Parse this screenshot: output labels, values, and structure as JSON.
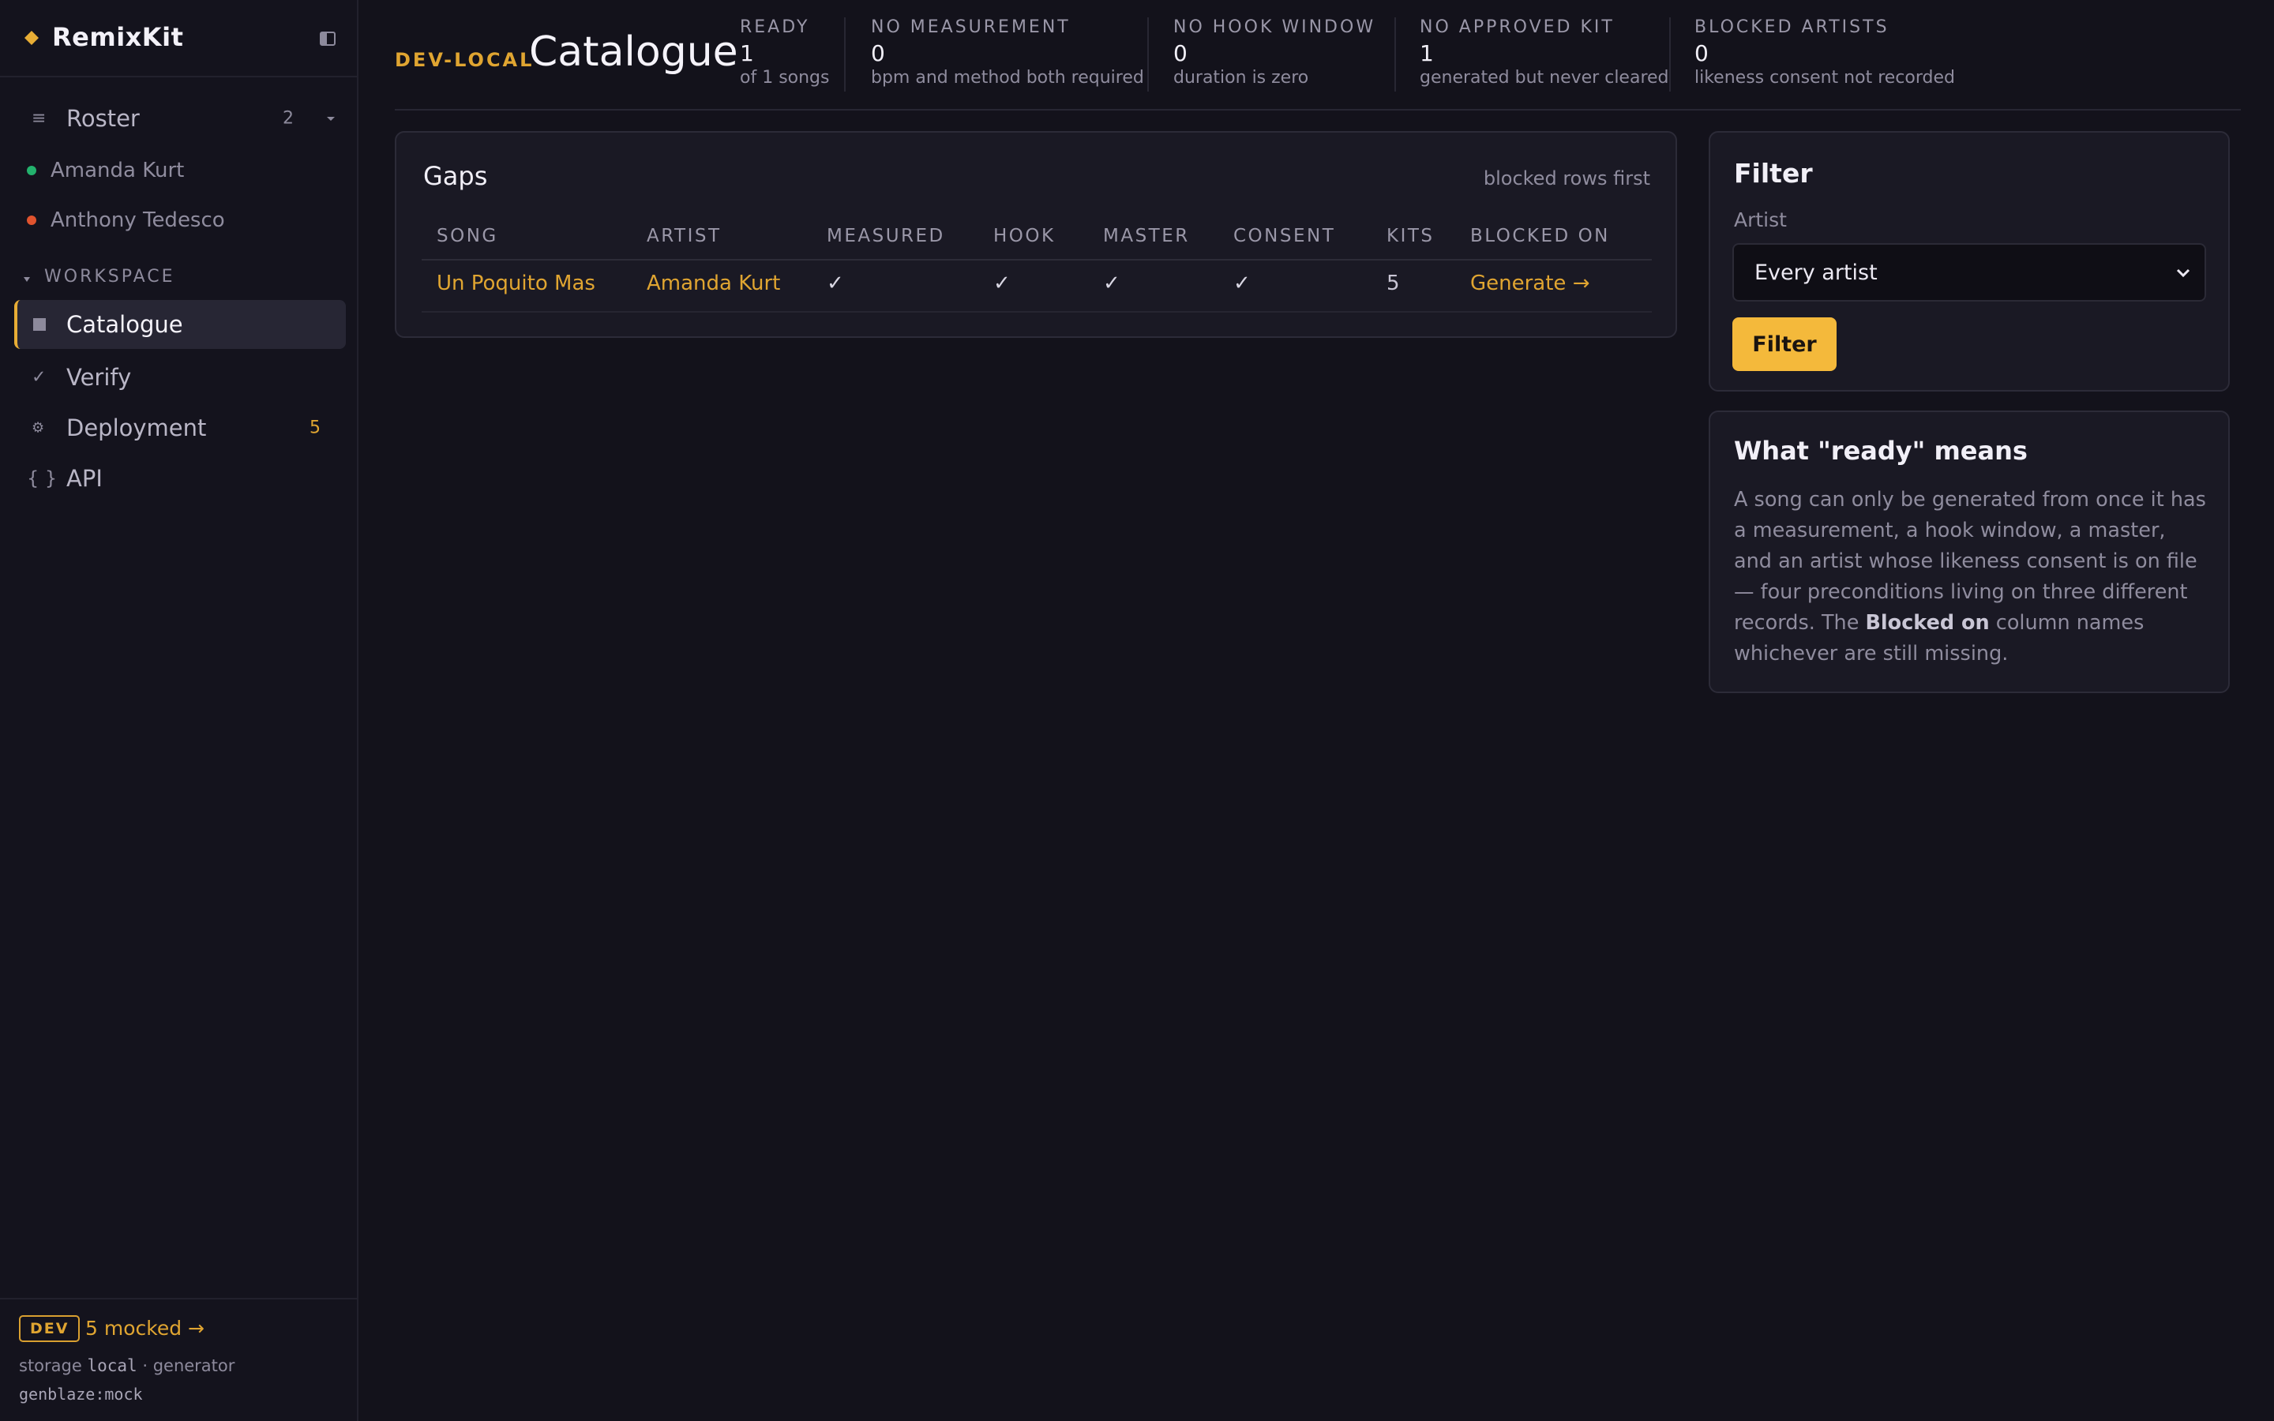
{
  "sidebar": {
    "brand": "RemixKit",
    "roster": {
      "label": "Roster",
      "count": "2"
    },
    "artists": [
      {
        "name": "Amanda Kurt",
        "color": "#23b26d"
      },
      {
        "name": "Anthony Tedesco",
        "color": "#e0532e"
      }
    ],
    "section": "WORKSPACE",
    "items": [
      {
        "icon": "▤",
        "label": "Catalogue",
        "count": ""
      },
      {
        "icon": "✓",
        "label": "Verify",
        "count": ""
      },
      {
        "icon": "⚙",
        "label": "Deployment",
        "count": "5"
      },
      {
        "icon": "{ }",
        "label": "API",
        "count": ""
      }
    ],
    "footer": {
      "badge": "DEV",
      "mocked": "5 mocked →",
      "storage_prefix": "storage ",
      "storage_value": "local",
      "storage_suffix": " · generator",
      "generator": "genblaze:mock"
    }
  },
  "header": {
    "env": "DEV-LOCAL",
    "title": "Catalogue",
    "stats": [
      {
        "key": "READY",
        "value": "1",
        "sub": "of 1 songs"
      },
      {
        "key": "NO MEASUREMENT",
        "value": "0",
        "sub": "bpm and method both required"
      },
      {
        "key": "NO HOOK WINDOW",
        "value": "0",
        "sub": "duration is zero"
      },
      {
        "key": "NO APPROVED KIT",
        "value": "1",
        "sub": "generated but never cleared"
      },
      {
        "key": "BLOCKED ARTISTS",
        "value": "0",
        "sub": "likeness consent not recorded"
      }
    ]
  },
  "gaps": {
    "title": "Gaps",
    "hint": "blocked rows first",
    "columns": [
      "SONG",
      "ARTIST",
      "MEASURED",
      "HOOK",
      "MASTER",
      "CONSENT",
      "KITS",
      "BLOCKED ON"
    ],
    "rows": [
      {
        "song": "Un Poquito Mas",
        "artist": "Amanda Kurt",
        "measured": "✓",
        "hook": "✓",
        "master": "✓",
        "consent": "✓",
        "kits": "5",
        "blocked_on": "Generate →"
      }
    ]
  },
  "filter": {
    "title": "Filter",
    "label": "Artist",
    "selected": "Every artist",
    "button": "Filter"
  },
  "ready_info": {
    "title": "What \"ready\" means",
    "body_before": "A song can only be generated from once it has a measurement, a hook window, a master, and an artist whose likeness consent is on file — four preconditions living on three different records. The ",
    "body_bold": "Blocked on",
    "body_after": " column names whichever are still missing."
  },
  "colors": {
    "accent": "#f4b93b",
    "background": "#13121b",
    "panel": "#1a1924"
  }
}
